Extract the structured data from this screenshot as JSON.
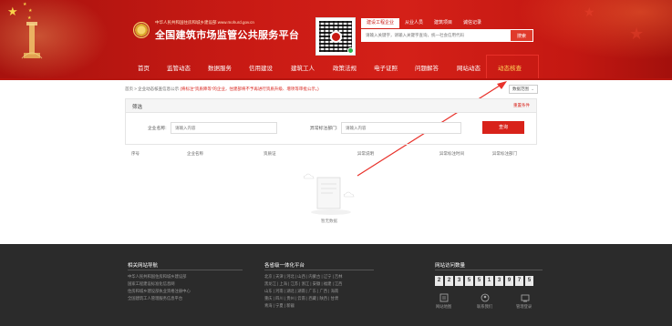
{
  "header": {
    "subtitle": "中华人民共和国住房和城乡建设部  www.mohurd.gov.cn",
    "title": "全国建筑市场监管公共服务平台",
    "search": {
      "tabs": [
        "建设工程企业",
        "从业人员",
        "建筑项目",
        "诚信记录"
      ],
      "placeholder": "请输入关键字，请输入关键字查询，统一社会信用代码",
      "button": "搜索"
    }
  },
  "nav": {
    "items": [
      "首页",
      "监管动态",
      "数据服务",
      "信用建设",
      "建筑工人",
      "政策法规",
      "电子证照",
      "问题解答",
      "网站动态",
      "动态核查"
    ],
    "active_index": 9
  },
  "breadcrumb": {
    "home": "首页",
    "sep": ">",
    "page": "企业动态核查信息公示",
    "warning": "(将标注“资质降等”的企业，住建部将不予再进行资质升级、增项等审批公示。)"
  },
  "scope_select": {
    "value": "数据范围"
  },
  "filter": {
    "title": "筛选",
    "clear": "重置条件",
    "company_label": "企业名称:",
    "company_placeholder": "请输入内容",
    "dept_label": "异常标注部门:",
    "dept_placeholder": "请输入内容",
    "query_button": "查询"
  },
  "table": {
    "headers": [
      "序号",
      "企业名称",
      "资质证",
      "异常说明",
      "异常标注时间",
      "异常标注部门"
    ]
  },
  "empty": {
    "text": "暂无数据"
  },
  "footer": {
    "links_title": "相关网站导航",
    "links": [
      "中华人民共和国住房和城乡建设部",
      "国家工程建设标准化信息网",
      "住房和城乡建设部执业资格注册中心",
      "全国建筑工人管理服务信息平台"
    ],
    "platform_title": "各省级一体化平台",
    "provinces": [
      "北京 | 天津 | 河北 | 山西 | 内蒙古 | 辽宁 | 吉林",
      "黑龙江 | 上海 | 江苏 | 浙江 | 安徽 | 福建 | 江西",
      "山东 | 河南 | 湖北 | 湖南 | 广东 | 广西 | 海南",
      "重庆 | 四川 | 贵州 | 云南 | 西藏 | 陕西 | 甘肃",
      "青海 | 宁夏 | 新疆"
    ],
    "visits_title": "网站访问数量",
    "visits_digits": [
      "2",
      "2",
      "3",
      "5",
      "5",
      "1",
      "3",
      "9",
      "7",
      "5"
    ],
    "icons": [
      {
        "name": "website-map-icon",
        "label": "网站地图"
      },
      {
        "name": "contact-icon",
        "label": "联系我们"
      },
      {
        "name": "admin-login-icon",
        "label": "管理登录"
      }
    ]
  },
  "colors": {
    "brand_red": "#c81a14",
    "active_nav": "#ffd35a",
    "footer_bg": "#2b2b2b"
  }
}
